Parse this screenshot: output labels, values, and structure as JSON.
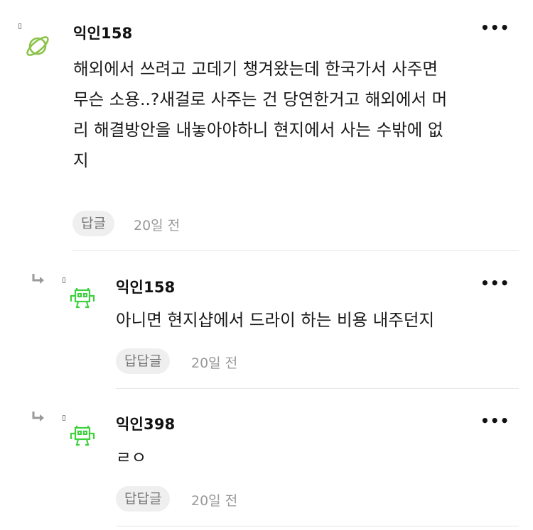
{
  "comments": [
    {
      "author": "익인158",
      "more": "•••",
      "lines": [
        "해외에서 쓰려고 고데기 챙겨왔는데 한국가서 사주면",
        "무슨 소용..?새걸로 사주는 건 당연한거고 해외에서 머",
        "리 해결방안을 내놓아야하니 현지에서 사는 수밖에 없",
        "지"
      ],
      "reply_label": "답글",
      "time": "20일 전",
      "avatar_icon": "planet-icon"
    },
    {
      "author": "익인158",
      "more": "•••",
      "lines": [
        "아니면 현지샵에서 드라이 하는 비용 내주던지"
      ],
      "reply_label": "답답글",
      "time": "20일 전",
      "avatar_icon": "space-invader-icon"
    },
    {
      "author": "익인398",
      "more": "•••",
      "lines": [
        "ㄹㅇ"
      ],
      "reply_label": "답답글",
      "time": "20일 전",
      "avatar_icon": "space-invader-icon"
    }
  ],
  "colors": {
    "planet": "#8bc34a",
    "invader": "#3ed13e",
    "reply_arrow": "#9a9a9a"
  }
}
